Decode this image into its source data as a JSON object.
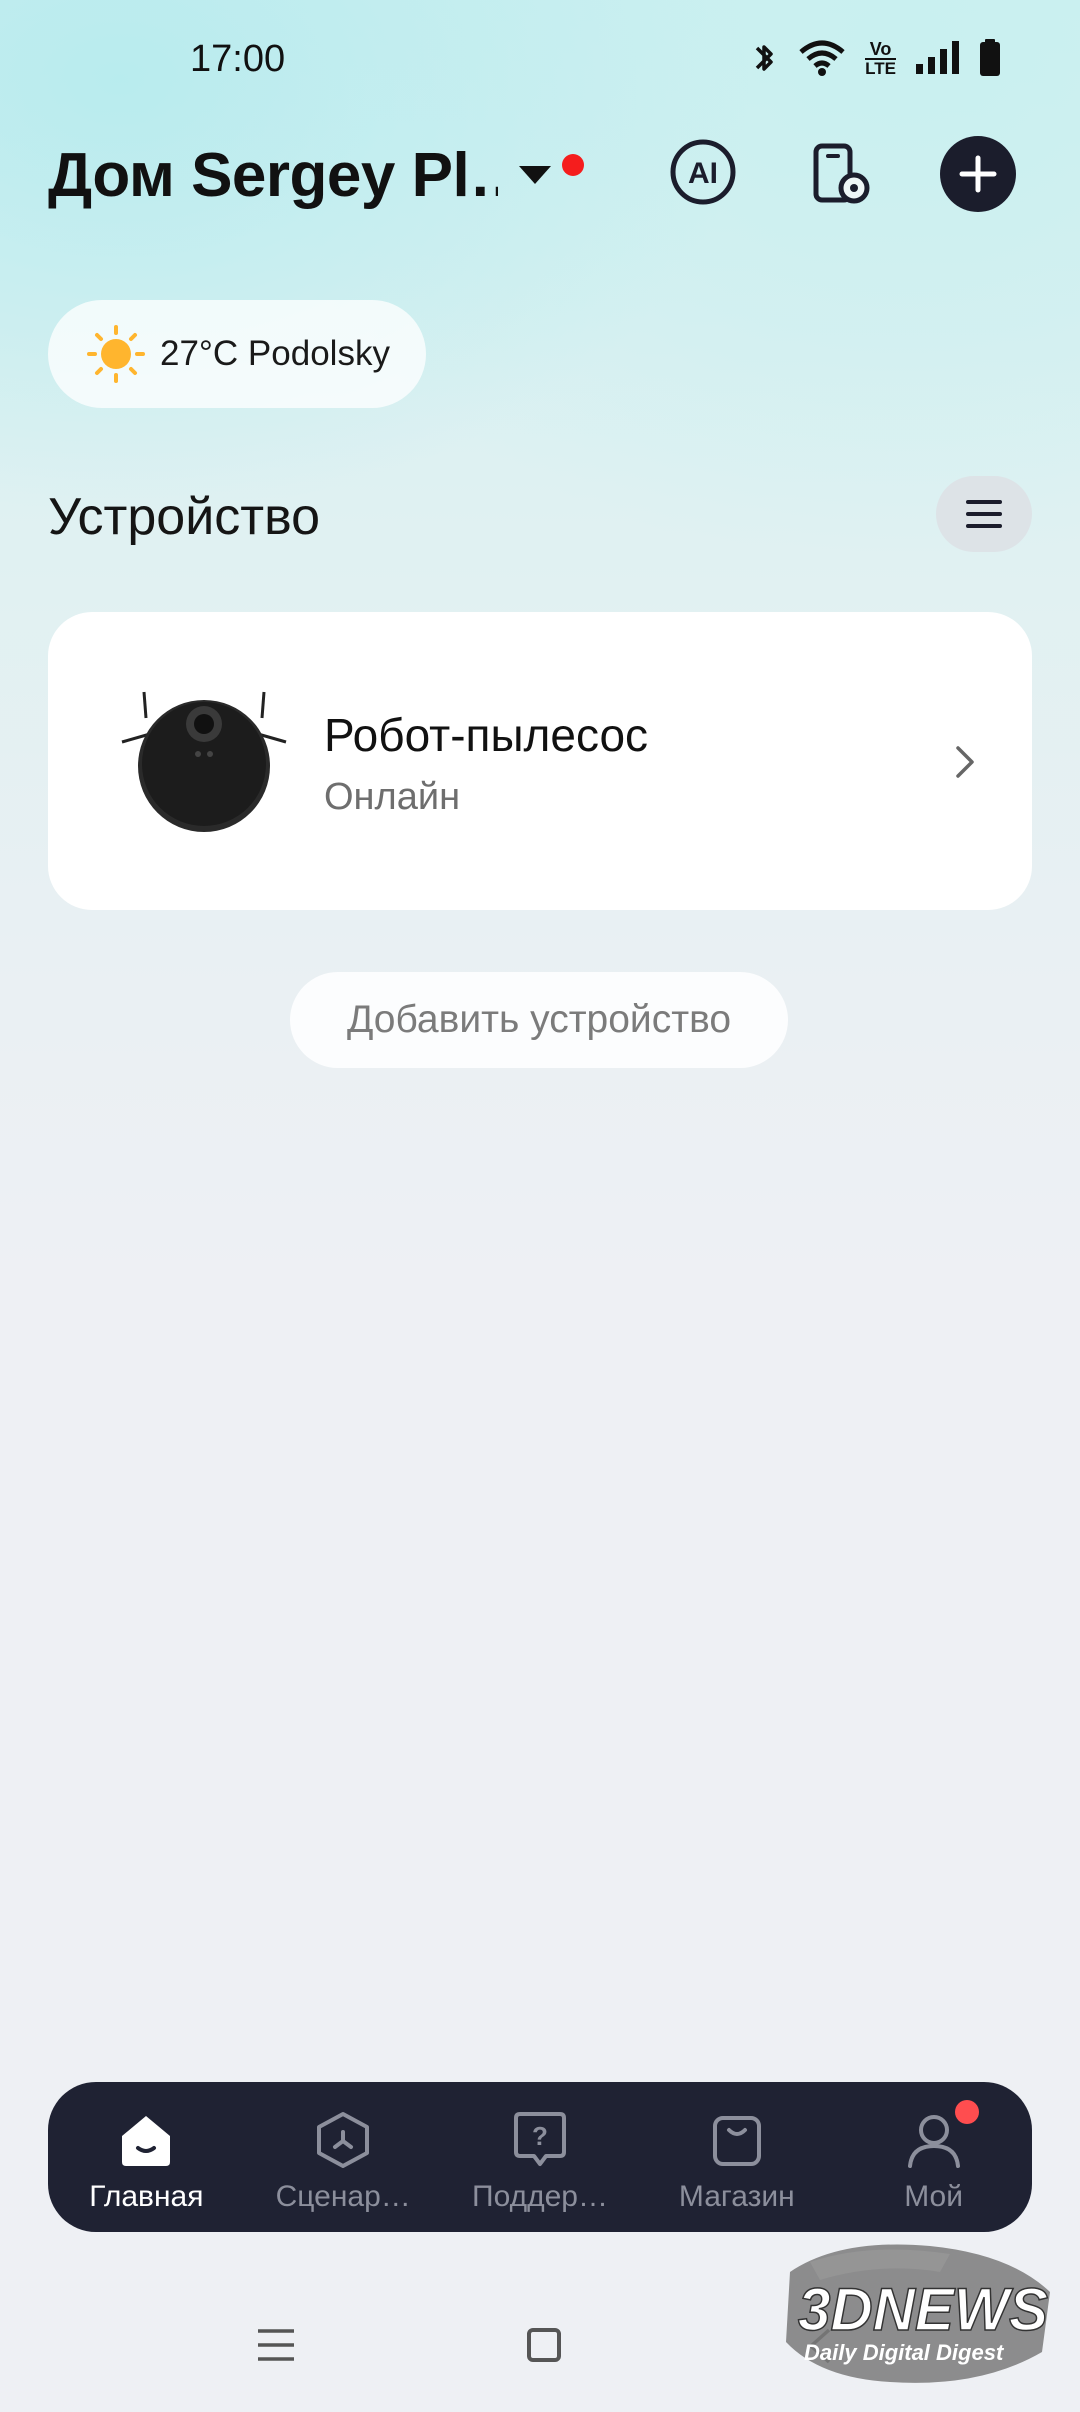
{
  "status_bar": {
    "time": "17:00",
    "icons": [
      "bluetooth-icon",
      "wifi-icon",
      "volte-icon",
      "signal-icon",
      "battery-icon"
    ],
    "volte_top": "Vo",
    "volte_bottom": "LTE"
  },
  "header": {
    "home_name": "Дом Sergey Pl…",
    "ai_label": "AI",
    "has_notification_dot": true
  },
  "weather": {
    "text": "27°C Podolsky",
    "icon": "sun-icon"
  },
  "section": {
    "title": "Устройство"
  },
  "devices": [
    {
      "name": "Робот-пылесос",
      "status": "Онлайн",
      "icon": "robot-vacuum-image"
    }
  ],
  "add_device_label": "Добавить устройство",
  "bottom_nav": {
    "items": [
      {
        "label": "Главная",
        "icon": "home-icon",
        "active": true
      },
      {
        "label": "Сценар…",
        "icon": "scenario-icon",
        "active": false
      },
      {
        "label": "Поддер…",
        "icon": "support-icon",
        "active": false
      },
      {
        "label": "Магазин",
        "icon": "shop-icon",
        "active": false
      },
      {
        "label": "Мой",
        "icon": "profile-icon",
        "active": false,
        "badge": true
      }
    ]
  },
  "watermark": {
    "brand": "3DNEWS",
    "tagline": "Daily Digital Digest"
  },
  "colors": {
    "accent_dark": "#1f2233",
    "notification_red": "#f51d1d"
  }
}
